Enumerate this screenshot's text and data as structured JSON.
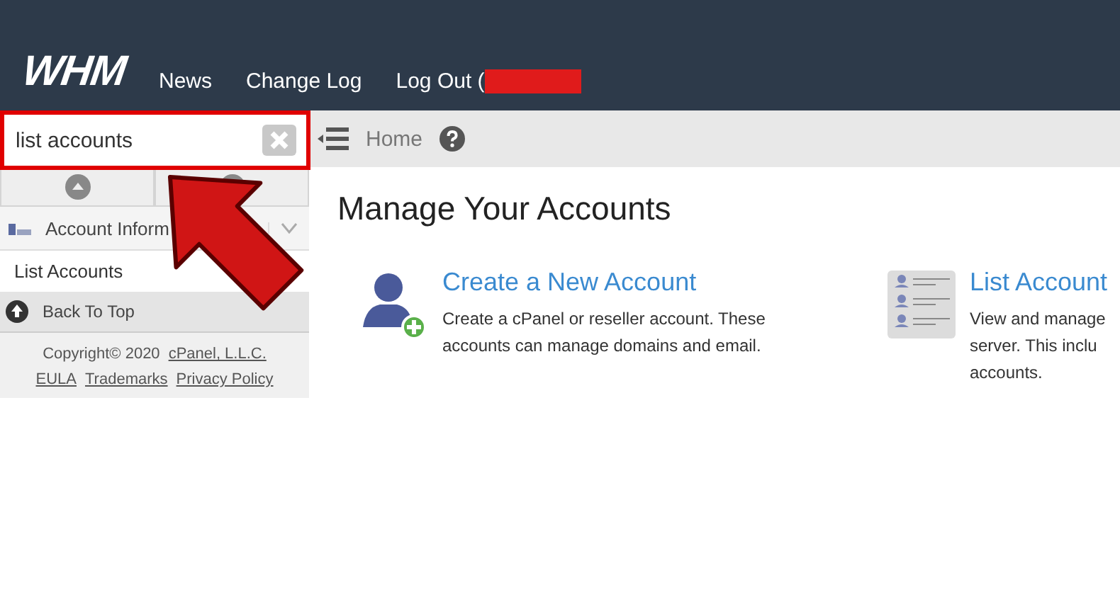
{
  "header": {
    "logo": "WHM",
    "nav": [
      {
        "label": "News"
      },
      {
        "label": "Change Log"
      },
      {
        "label": "Log Out ("
      }
    ]
  },
  "sidebar": {
    "search": {
      "value": "list accounts"
    },
    "category": {
      "label": "Account Inform"
    },
    "items": [
      {
        "label": "List Accounts"
      }
    ],
    "back_to_top": "Back To Top",
    "footer": {
      "copyright": "Copyright© 2020",
      "company": "cPanel, L.L.C.",
      "links": [
        "EULA",
        "Trademarks",
        "Privacy Policy"
      ]
    }
  },
  "breadcrumb": {
    "label": "Home"
  },
  "main": {
    "title": "Manage Your Accounts",
    "cards": [
      {
        "kind": "create",
        "title": "Create a New Account",
        "lines": [
          "Create a cPanel or reseller account. These",
          "accounts can manage domains and email."
        ]
      },
      {
        "kind": "list",
        "title": "List Account",
        "lines": [
          "View and manage",
          "server. This inclu",
          "accounts."
        ]
      }
    ]
  }
}
